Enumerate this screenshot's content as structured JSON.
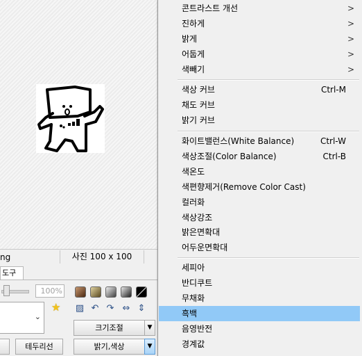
{
  "status": {
    "left_text": "ng",
    "photo_size": "사진 100 x 100"
  },
  "toolpanel": {
    "tab_label": "도구",
    "zoom_value": "100%",
    "swatch_colors": [
      "#6b3e1e",
      "#8b7a4a",
      "#7a7a7a",
      "#555555",
      "#222222"
    ],
    "resize_label": "크기조절",
    "brightness_color_label": "밝기,색상",
    "border_label": "테두리선"
  },
  "menu": {
    "group1": [
      {
        "label": "콘트라스트 개선",
        "submenu": ">"
      },
      {
        "label": "진하게",
        "submenu": ">"
      },
      {
        "label": "밝게",
        "submenu": ">"
      },
      {
        "label": "어둡게",
        "submenu": ">"
      },
      {
        "label": "색빼기",
        "submenu": ">"
      }
    ],
    "group2": [
      {
        "label": "색상 커브",
        "shortcut": "Ctrl-M"
      },
      {
        "label": "채도 커브"
      },
      {
        "label": "밝기 커브"
      }
    ],
    "group3": [
      {
        "label": "화이트밸런스(White Balance)",
        "shortcut": "Ctrl-W"
      },
      {
        "label": "색상조절(Color Balance)",
        "shortcut": "Ctrl-B"
      },
      {
        "label": "색온도"
      },
      {
        "label": "색편향제거(Remove Color Cast)"
      },
      {
        "label": "컬러화"
      },
      {
        "label": "색상강조"
      },
      {
        "label": "밝은면확대"
      },
      {
        "label": "어두운면확대"
      }
    ],
    "group4": [
      {
        "label": "세피아"
      },
      {
        "label": "반디쿠트"
      },
      {
        "label": "무채화"
      },
      {
        "label": "흑백"
      },
      {
        "label": "음영반전"
      },
      {
        "label": "경계값"
      }
    ],
    "highlight_color": "#91c9f7"
  }
}
